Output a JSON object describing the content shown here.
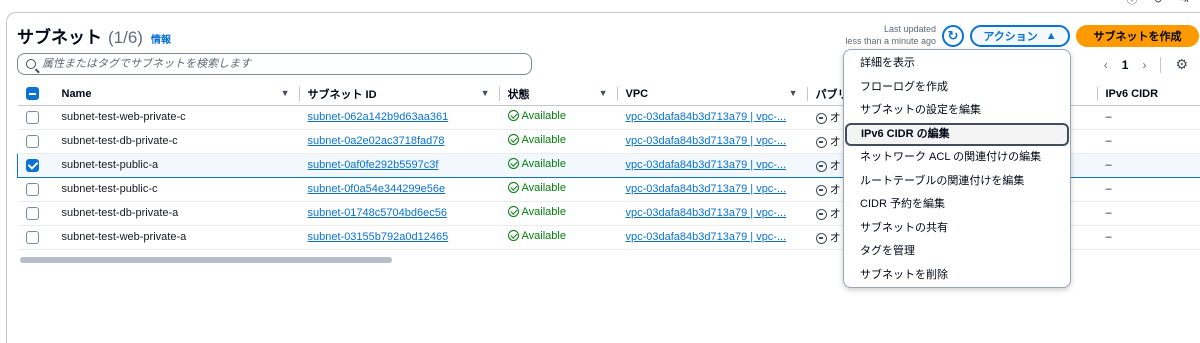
{
  "header": {
    "title": "サブネット",
    "count": "(1/6)",
    "info": "情報",
    "last_updated_label": "Last updated",
    "last_updated_value": "less than a minute ago",
    "actions_label": "アクション",
    "create_label": "サブネットを作成"
  },
  "search": {
    "placeholder": "属性またはタグでサブネットを検索します"
  },
  "pagination": {
    "current_page": "1"
  },
  "table": {
    "columns": [
      "Name",
      "サブネット ID",
      "状態",
      "VPC",
      "パブリ",
      "IPv6 CIDR"
    ],
    "rows": [
      {
        "name": "subnet-test-web-private-c",
        "id": "subnet-062a142b9d63aa361",
        "state": "Available",
        "vpc": "vpc-03dafa84b3d713a79 | vpc-...",
        "public": "オ",
        "ipv6": "–",
        "selected": false
      },
      {
        "name": "subnet-test-db-private-c",
        "id": "subnet-0a2e02ac3718fad78",
        "state": "Available",
        "vpc": "vpc-03dafa84b3d713a79 | vpc-...",
        "public": "オ",
        "ipv6": "–",
        "selected": false
      },
      {
        "name": "subnet-test-public-a",
        "id": "subnet-0af0fe292b5597c3f",
        "state": "Available",
        "vpc": "vpc-03dafa84b3d713a79 | vpc-...",
        "public": "オ",
        "ipv6": "–",
        "selected": true
      },
      {
        "name": "subnet-test-public-c",
        "id": "subnet-0f0a54e344299e56e",
        "state": "Available",
        "vpc": "vpc-03dafa84b3d713a79 | vpc-...",
        "public": "オ",
        "ipv6": "–",
        "selected": false
      },
      {
        "name": "subnet-test-db-private-a",
        "id": "subnet-01748c5704bd6ec56",
        "state": "Available",
        "vpc": "vpc-03dafa84b3d713a79 | vpc-...",
        "public": "オ",
        "ipv6": "–",
        "selected": false
      },
      {
        "name": "subnet-test-web-private-a",
        "id": "subnet-03155b792a0d12465",
        "state": "Available",
        "vpc": "vpc-03dafa84b3d713a79 | vpc-...",
        "public": "オ",
        "ipv6": "–",
        "selected": false
      }
    ]
  },
  "menu": {
    "items": [
      "詳細を表示",
      "フローログを作成",
      "サブネットの設定を編集",
      "IPv6 CIDR の編集",
      "ネットワーク ACL の関連付けの編集",
      "ルートテーブルの関連付けを編集",
      "CIDR 予約を編集",
      "サブネットの共有",
      "タグを管理",
      "サブネットを削除"
    ],
    "highlighted_index": 3
  },
  "colors": {
    "accent": "#0972d3",
    "create_button": "#ff9900",
    "available": "#037f0c"
  }
}
